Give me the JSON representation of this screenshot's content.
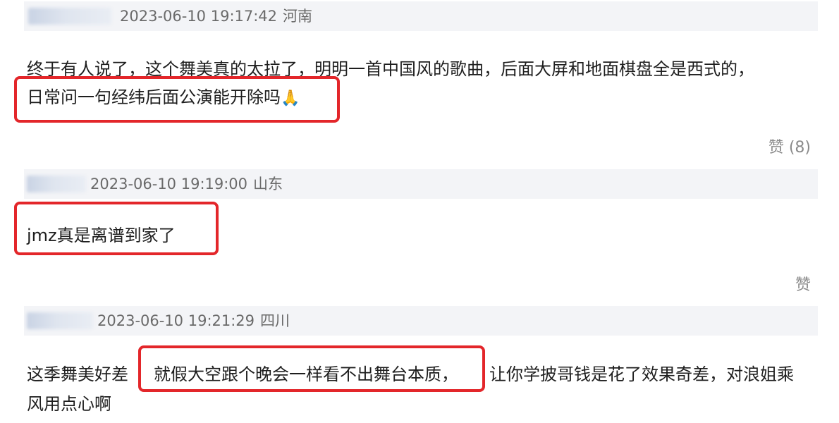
{
  "comments": [
    {
      "timestamp": "2023-06-10 19:17:42",
      "location": "河南",
      "lines": [
        "终于有人说了，这个舞美真的太拉了，明明一首中国风的歌曲，后面大屏和地面棋盘全是西式的，",
        "日常问一句经纬后面公演能开除吗"
      ],
      "emoji": "🙏",
      "like": "赞 (8)"
    },
    {
      "timestamp": "2023-06-10 19:19:00",
      "location": "山东",
      "lines": [
        "jmz真是离谱到家了"
      ],
      "like": "赞"
    },
    {
      "timestamp": "2023-06-10 19:21:29",
      "location": "四川",
      "line1_before": "这季舞美好差",
      "line1_highlight": "就假大空跟个晚会一样看不出舞台本质，",
      "line1_after": "让你学披哥钱是花了效果奇差，对浪姐乘",
      "line2": "风用点心啊"
    }
  ],
  "colors": {
    "highlight_border": "#e3262a",
    "header_bg": "#f3f4f7",
    "meta_text": "#6a6a6a",
    "like_text": "#8a8a8a"
  },
  "icons": [
    "folded-hands-emoji"
  ]
}
